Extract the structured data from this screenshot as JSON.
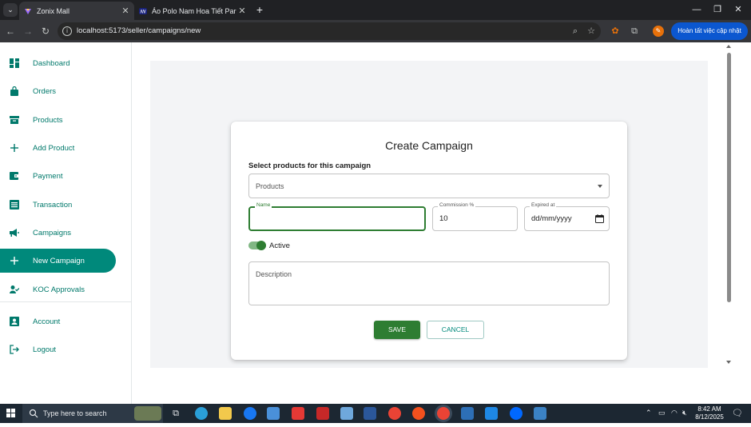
{
  "browser": {
    "tabs": [
      {
        "title": "Zonix Mall",
        "active": true,
        "favicon": "zonix-logo"
      },
      {
        "title": "Áo Polo Nam Hoa Tiết Paris Fo…",
        "active": false,
        "favicon": "site-logo"
      }
    ],
    "url": "localhost:5173/seller/campaigns/new",
    "update_button": "Hoàn tất việc cập nhật"
  },
  "sidebar": {
    "items": [
      {
        "label": "Dashboard",
        "icon": "dashboard-icon"
      },
      {
        "label": "Orders",
        "icon": "shopping-bag-icon"
      },
      {
        "label": "Products",
        "icon": "archive-box-icon"
      },
      {
        "label": "Add Product",
        "icon": "plus-icon"
      },
      {
        "label": "Payment",
        "icon": "wallet-icon"
      },
      {
        "label": "Transaction",
        "icon": "receipt-icon"
      },
      {
        "label": "Campaigns",
        "icon": "megaphone-icon"
      },
      {
        "label": "New Campaign",
        "icon": "plus-icon",
        "active": true
      },
      {
        "label": "KOC Approvals",
        "icon": "person-check-icon"
      },
      {
        "label": "Account",
        "icon": "account-box-icon"
      },
      {
        "label": "Logout",
        "icon": "logout-icon"
      }
    ]
  },
  "form": {
    "title": "Create Campaign",
    "products_section_label": "Select products for this campaign",
    "products_placeholder": "Products",
    "name_label": "Name",
    "name_value": "",
    "commission_label": "Commission %",
    "commission_value": "10",
    "expired_label": "Expired at",
    "expired_value": "dd/mm/yyyy",
    "active_label": "Active",
    "active": true,
    "description_placeholder": "Description",
    "save_label": "SAVE",
    "cancel_label": "CANCEL"
  },
  "taskbar": {
    "search_placeholder": "Type here to search",
    "time": "8:42 AM",
    "date": "8/12/2025"
  },
  "colors": {
    "accent": "#00897b",
    "primary_green": "#2e7d32",
    "panel_bg": "#f3f4f6"
  }
}
